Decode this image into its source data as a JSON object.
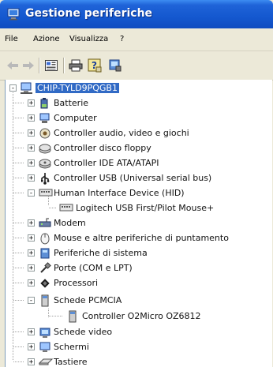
{
  "window": {
    "title": "Gestione periferiche"
  },
  "menu": {
    "items": [
      "File",
      "Azione",
      "Visualizza",
      "?"
    ]
  },
  "toolbar": {
    "buttons": [
      "back-arrow",
      "forward-arrow",
      "properties",
      "print",
      "help",
      "scan-hardware"
    ]
  },
  "tree": {
    "root": "CHIP-TYLD9PQGB1",
    "items": [
      {
        "label": "Batterie",
        "expander": "+",
        "icon": "battery-icon",
        "level": 1
      },
      {
        "label": "Computer",
        "expander": "+",
        "icon": "computer-icon",
        "level": 1
      },
      {
        "label": "Controller audio, video e giochi",
        "expander": "+",
        "icon": "sound-icon",
        "level": 1
      },
      {
        "label": "Controller disco floppy",
        "expander": "+",
        "icon": "floppy-controller-icon",
        "level": 1
      },
      {
        "label": "Controller IDE ATA/ATAPI",
        "expander": "+",
        "icon": "ide-controller-icon",
        "level": 1
      },
      {
        "label": "Controller USB (Universal serial bus)",
        "expander": "+",
        "icon": "usb-icon",
        "level": 1
      },
      {
        "label": "Human Interface Device (HID)",
        "expander": "-",
        "icon": "hid-icon",
        "level": 1
      },
      {
        "label": "Logitech USB First/Pilot Mouse+",
        "expander": "",
        "icon": "hid-device-icon",
        "level": 2
      },
      {
        "label": "Modem",
        "expander": "+",
        "icon": "modem-icon",
        "level": 1
      },
      {
        "label": "Mouse e altre periferiche di puntamento",
        "expander": "+",
        "icon": "mouse-icon",
        "level": 1
      },
      {
        "label": "Periferiche di sistema",
        "expander": "+",
        "icon": "system-devices-icon",
        "level": 1
      },
      {
        "label": "Porte (COM e LPT)",
        "expander": "+",
        "icon": "port-icon",
        "level": 1
      },
      {
        "label": "Processori",
        "expander": "+",
        "icon": "processor-icon",
        "level": 1
      },
      {
        "label": "Schede PCMCIA",
        "expander": "-",
        "icon": "pcmcia-icon",
        "level": 1
      },
      {
        "label": "Controller O2Micro OZ6812",
        "expander": "",
        "icon": "pcmcia-controller-icon",
        "level": 2
      },
      {
        "label": "Schede video",
        "expander": "+",
        "icon": "display-adapter-icon",
        "level": 1
      },
      {
        "label": "Schermi",
        "expander": "+",
        "icon": "monitor-icon",
        "level": 1
      },
      {
        "label": "Tastiere",
        "expander": "+",
        "icon": "keyboard-icon",
        "level": 1
      }
    ]
  },
  "colors": {
    "titlebar": "#1458cf",
    "selection": "#316ac5",
    "chrome": "#ece9d8"
  }
}
